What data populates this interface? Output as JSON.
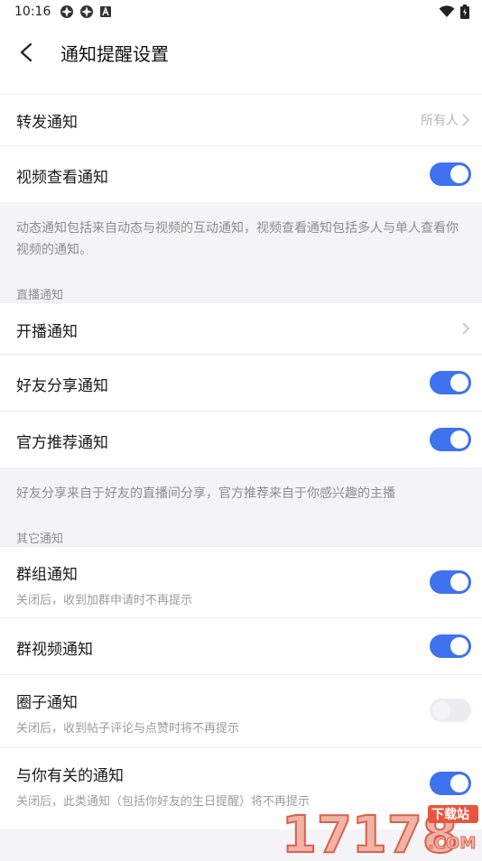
{
  "status": {
    "time": "10:16"
  },
  "header": {
    "title": "通知提醒设置"
  },
  "rows_a": [
    {
      "label": "转发通知",
      "value": "所有人",
      "type": "link"
    },
    {
      "label": "视频查看通知",
      "type": "toggle",
      "on": true
    }
  ],
  "note_a": "动态通知包括来自动态与视频的互动通知，视频查看通知包括多人与单人查看你视频的通知。",
  "section_live": "直播通知",
  "rows_b": [
    {
      "label": "开播通知",
      "type": "link"
    },
    {
      "label": "好友分享通知",
      "type": "toggle",
      "on": true
    },
    {
      "label": "官方推荐通知",
      "type": "toggle",
      "on": true
    }
  ],
  "note_b": "好友分享来自于好友的直播间分享，官方推荐来自于你感兴趣的主播",
  "section_other": "其它通知",
  "rows_c": [
    {
      "label": "群组通知",
      "sub": "关闭后，收到加群申请时不再提示",
      "type": "toggle",
      "on": true
    },
    {
      "label": "群视频通知",
      "type": "toggle",
      "on": true
    },
    {
      "label": "圈子通知",
      "sub": "关闭后，收到帖子评论与点赞时将不再提示",
      "type": "toggle",
      "on": false
    },
    {
      "label": "与你有关的通知",
      "sub": "关闭后，此类通知（包括你好友的生日提醒）将不再提示",
      "type": "toggle",
      "on": true
    }
  ],
  "watermark": {
    "text": "17178",
    "badge": "下载站",
    "domain": ".COM"
  },
  "colors": {
    "accent": "#3e72ef",
    "background": "#f4f4f6"
  }
}
